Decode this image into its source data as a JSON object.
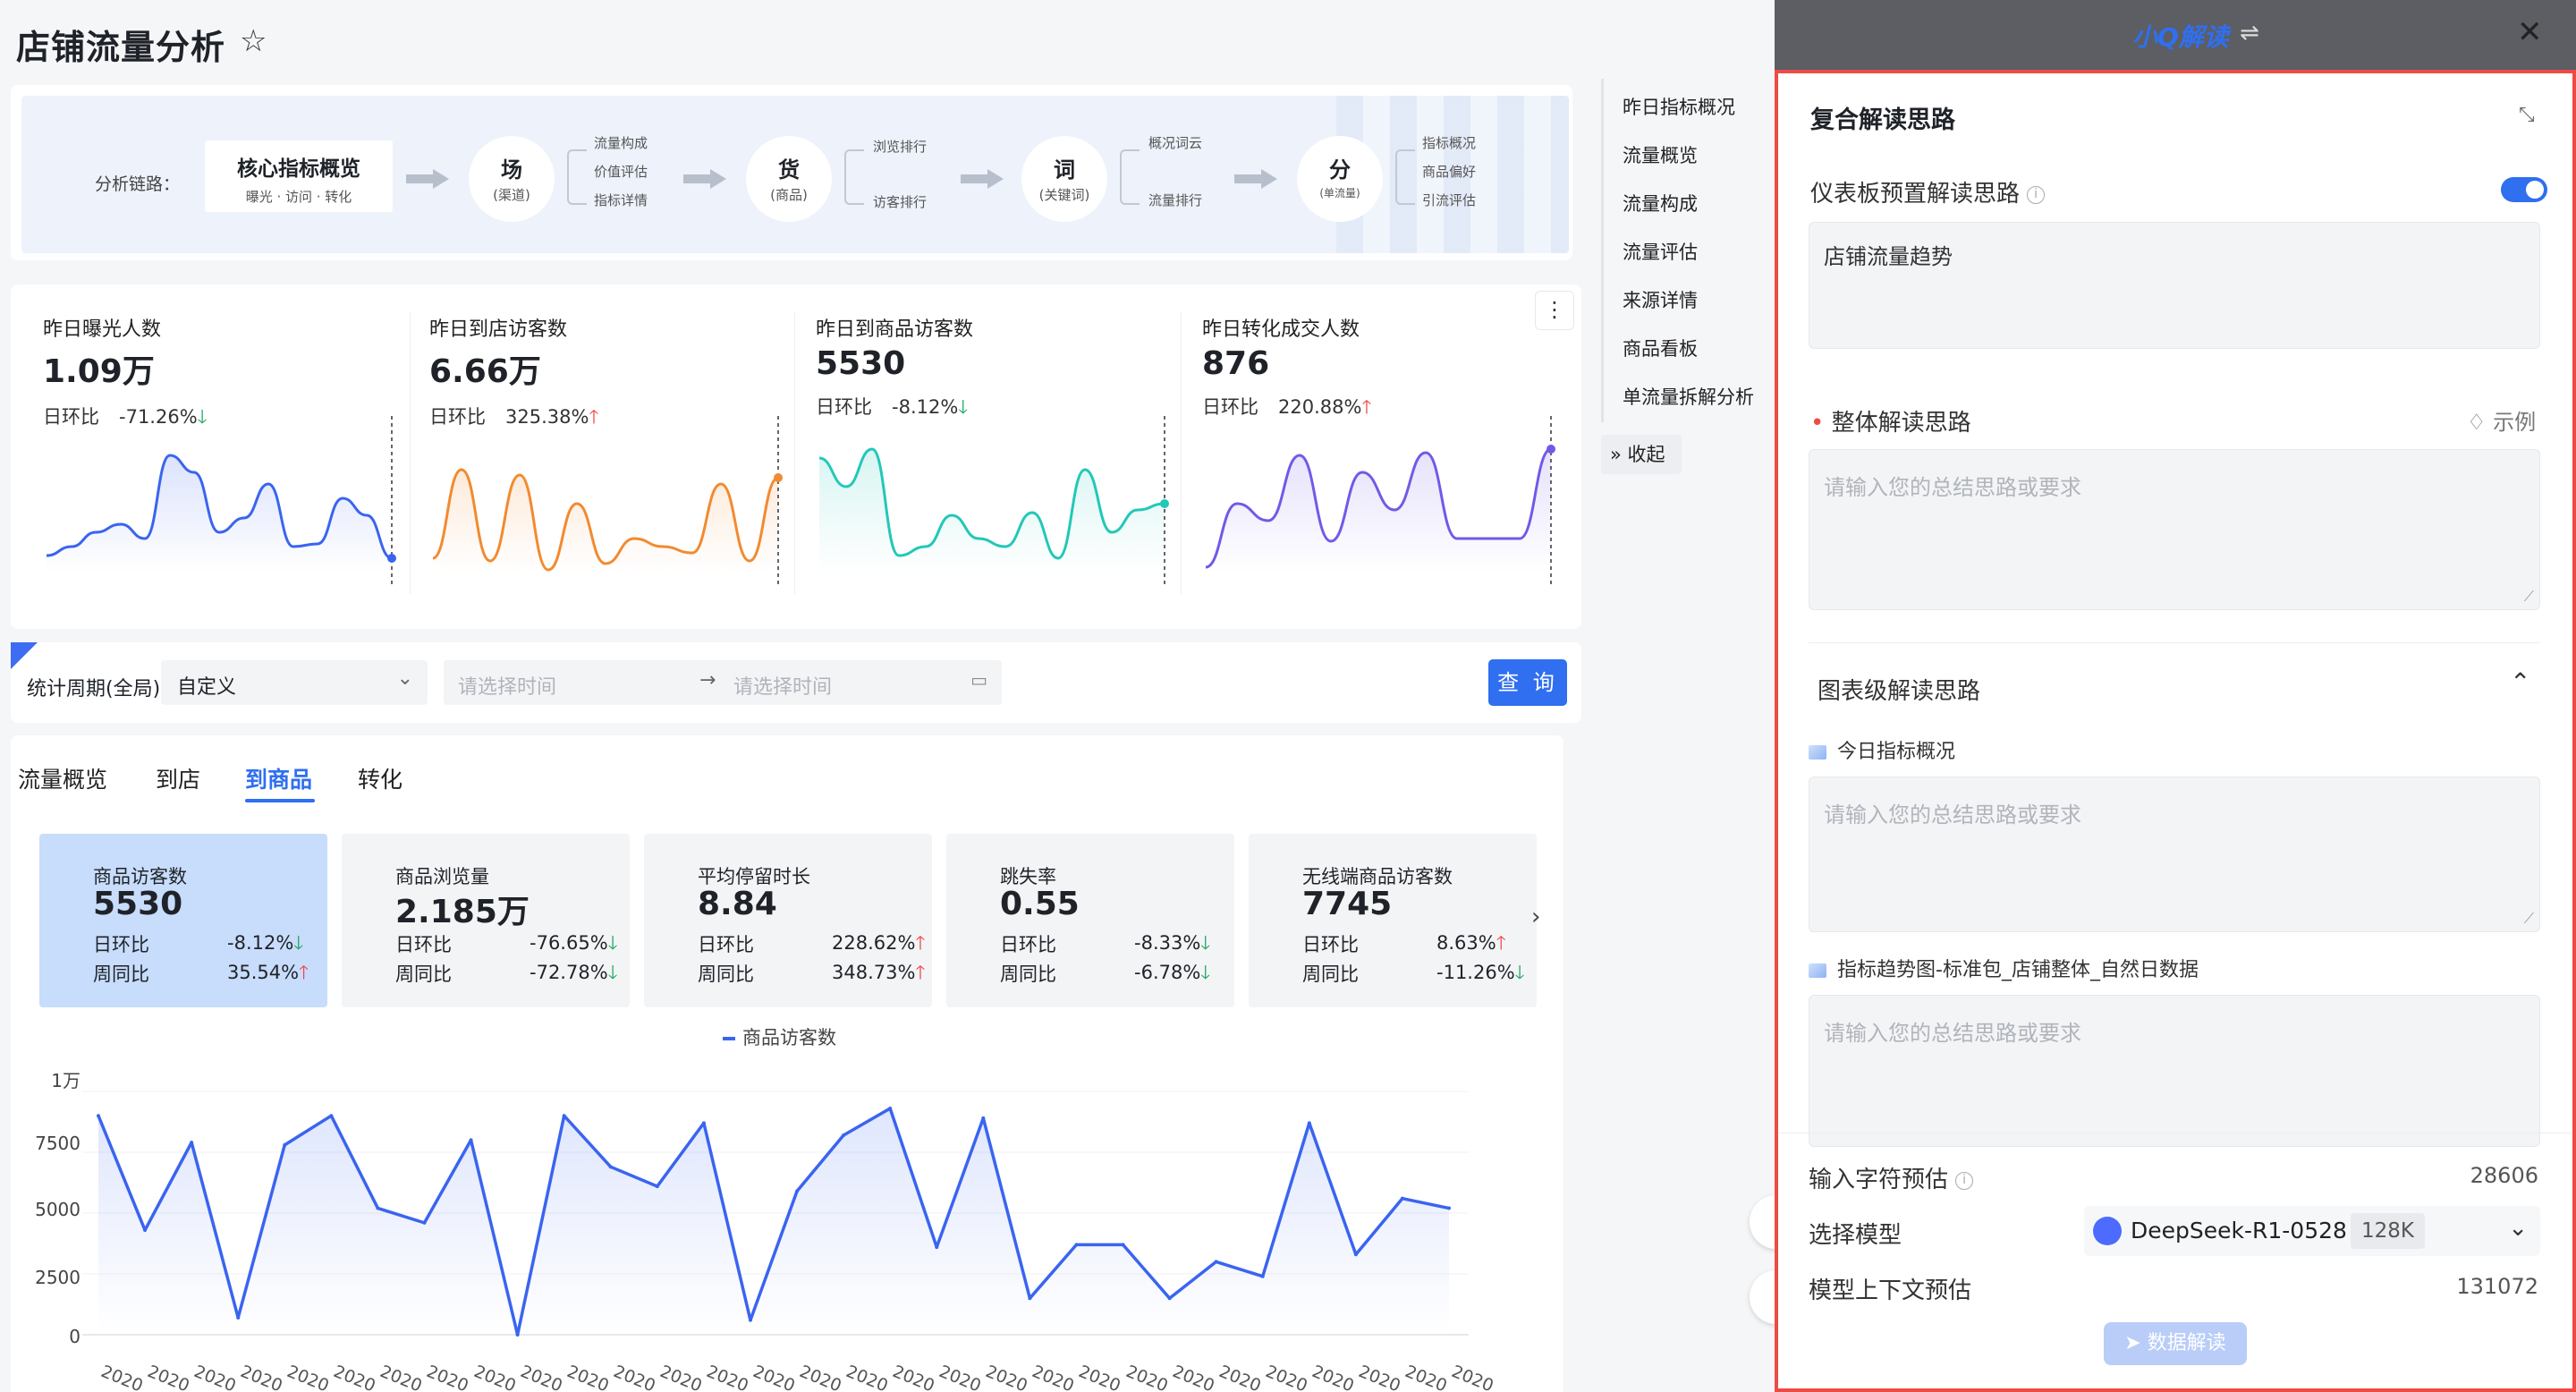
{
  "page": {
    "title": "店铺流量分析"
  },
  "chain": {
    "label": "分析链路：",
    "core_title": "核心指标概览",
    "core_sub": "曝光 · 访问 · 转化",
    "nodes": [
      {
        "main": "场",
        "sub": "(渠道)",
        "items": [
          "流量构成",
          "价值评估",
          "指标详情"
        ]
      },
      {
        "main": "货",
        "sub": "(商品)",
        "items": [
          "浏览排行",
          "访客排行"
        ]
      },
      {
        "main": "词",
        "sub": "(关键词)",
        "items": [
          "概况词云",
          "流量排行"
        ]
      },
      {
        "main": "分",
        "sub": "(单流量)",
        "items": [
          "指标概况",
          "商品偏好",
          "引流评估"
        ]
      }
    ]
  },
  "metrics": [
    {
      "label": "昨日曝光人数",
      "value": "1.09万",
      "cmp_label": "日环比",
      "pct": "-71.26%",
      "dir": "down",
      "color": "#3a64f0",
      "series": [
        12,
        18,
        28,
        34,
        24,
        82,
        70,
        28,
        38,
        62,
        18,
        20,
        52,
        40,
        10
      ]
    },
    {
      "label": "昨日到店访客数",
      "value": "6.66万",
      "cmp_label": "日环比",
      "pct": "325.38%",
      "dir": "up",
      "color": "#f28a30",
      "series": [
        10,
        72,
        8,
        68,
        2,
        48,
        6,
        24,
        18,
        14,
        62,
        8,
        66
      ]
    },
    {
      "label": "昨日到商品访客数",
      "value": "5530",
      "cmp_label": "日环比",
      "pct": "-8.12%",
      "dir": "down",
      "color": "#22c8b8",
      "series": [
        80,
        60,
        86,
        12,
        18,
        40,
        24,
        18,
        42,
        10,
        72,
        28,
        44,
        48
      ]
    },
    {
      "label": "昨日转化成交人数",
      "value": "876",
      "cmp_label": "日环比",
      "pct": "220.88%",
      "dir": "up",
      "color": "#7358e8",
      "series": [
        4,
        48,
        36,
        82,
        22,
        70,
        44,
        84,
        24,
        24,
        24,
        86
      ]
    }
  ],
  "filter": {
    "label": "统计周期(全局)",
    "select_value": "自定义",
    "date_start_placeholder": "请选择时间",
    "date_end_placeholder": "请选择时间",
    "query_label": "查 询"
  },
  "tabs": [
    "流量概览",
    "到店",
    "到商品",
    "转化"
  ],
  "kpis": [
    {
      "label": "商品访客数",
      "value": "5530",
      "r1_label": "日环比",
      "r1": "-8.12%",
      "r1_dir": "down",
      "r2_label": "周同比",
      "r2": "35.54%",
      "r2_dir": "up"
    },
    {
      "label": "商品浏览量",
      "value": "2.185万",
      "r1_label": "日环比",
      "r1": "-76.65%",
      "r1_dir": "down",
      "r2_label": "周同比",
      "r2": "-72.78%",
      "r2_dir": "down"
    },
    {
      "label": "平均停留时长",
      "value": "8.84",
      "r1_label": "日环比",
      "r1": "228.62%",
      "r1_dir": "up",
      "r2_label": "周同比",
      "r2": "348.73%",
      "r2_dir": "up"
    },
    {
      "label": "跳失率",
      "value": "0.55",
      "r1_label": "日环比",
      "r1": "-8.33%",
      "r1_dir": "down",
      "r2_label": "周同比",
      "r2": "-6.78%",
      "r2_dir": "down"
    },
    {
      "label": "无线端商品访客数",
      "value": "7745",
      "r1_label": "日环比",
      "r1": "8.63%",
      "r1_dir": "up",
      "r2_label": "周同比",
      "r2": "-11.26%",
      "r2_dir": "down"
    }
  ],
  "chart_data": {
    "type": "area",
    "series": [
      {
        "name": "商品访客数",
        "values": [
          9000,
          4300,
          7900,
          700,
          7800,
          9000,
          5200,
          4600,
          8000,
          0,
          9000,
          6900,
          6100,
          8700,
          600,
          5900,
          8200,
          9300,
          3600,
          8900,
          1500,
          3700,
          3700,
          1500,
          3000,
          2400,
          8700,
          3300,
          5600,
          5200
        ]
      }
    ],
    "yticks": [
      "1万",
      "7500",
      "5000",
      "2500",
      "0"
    ],
    "ylim": [
      0,
      10000
    ],
    "xtick_label": "2020"
  },
  "nav": {
    "items": [
      "昨日指标概况",
      "流量概览",
      "流量构成",
      "流量评估",
      "来源详情",
      "商品看板",
      "单流量拆解分析"
    ],
    "collapse_label": "收起"
  },
  "panel": {
    "header_title": "小Q解读",
    "section_title": "复合解读思路",
    "preset_label": "仪表板预置解读思路",
    "preset_text": "店铺流量趋势",
    "overall_label": "整体解读思路",
    "example_label": "示例",
    "placeholder": "请输入您的总结思路或要求",
    "chart_level_label": "图表级解读思路",
    "chart_items": [
      "今日指标概况",
      "指标趋势图-标准包_店铺整体_自然日数据"
    ],
    "input_chars_label": "输入字符预估",
    "input_chars_value": "28606",
    "model_label": "选择模型",
    "model_name": "DeepSeek-R1-0528",
    "model_ctx": "128K",
    "context_label": "模型上下文预估",
    "context_value": "131072",
    "run_label": "数据解读"
  }
}
